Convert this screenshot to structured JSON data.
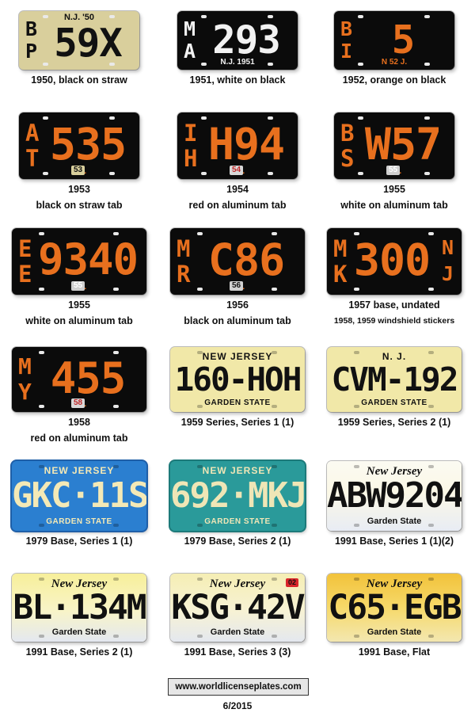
{
  "plates": [
    {
      "top": "N.J. '50",
      "prefix": [
        "B",
        "P"
      ],
      "number": "59X",
      "caption": [
        "1950, black on straw"
      ]
    },
    {
      "bottom": "N.J. 1951",
      "prefix": [
        "M",
        "A"
      ],
      "number": "293",
      "caption": [
        "1951, white on black"
      ]
    },
    {
      "bottom": "N 52 J.",
      "prefix": [
        "B",
        "I"
      ],
      "number": "5",
      "caption": [
        "1952, orange on black"
      ]
    },
    {
      "bottom": "N J.",
      "tab": "53",
      "prefix": [
        "A",
        "T"
      ],
      "number": "535",
      "caption": [
        "1953",
        "black on straw tab"
      ]
    },
    {
      "bottom": "N J.",
      "tab": "54",
      "prefix": [
        "I",
        "H"
      ],
      "number": "H94",
      "caption": [
        "1954",
        "red on aluminum tab"
      ]
    },
    {
      "bottom": "N J.",
      "tab": "55",
      "prefix": [
        "B",
        "S"
      ],
      "number": "W57",
      "caption": [
        "1955",
        "white on aluminum tab"
      ]
    },
    {
      "bottom": "N J.",
      "tab": "55",
      "prefix": [
        "E",
        "E"
      ],
      "number": "9340",
      "caption": [
        "1955",
        "white on aluminum tab"
      ]
    },
    {
      "bottom": "N J.",
      "tab": "56",
      "prefix": [
        "M",
        "R"
      ],
      "number": "C86",
      "caption": [
        "1956",
        "black on aluminum tab"
      ]
    },
    {
      "prefix": [
        "M",
        "K"
      ],
      "number": "300",
      "suffix": [
        "N",
        "J"
      ],
      "caption": [
        "1957 base, undated",
        "1958, 1959 windshield stickers"
      ]
    },
    {
      "bottom": "N J.",
      "tab": "58",
      "prefix": [
        "M",
        "Y"
      ],
      "number": "455",
      "caption": [
        "1958",
        "red on aluminum tab"
      ]
    },
    {
      "top": "NEW JERSEY",
      "number": "160-HOH",
      "bottom": "GARDEN STATE",
      "caption": [
        "1959 Series, Series 1 (1)"
      ]
    },
    {
      "top": "N. J.",
      "number": "CVM-192",
      "bottom": "GARDEN STATE",
      "caption": [
        "1959 Series, Series 2 (1)"
      ]
    },
    {
      "top": "NEW JERSEY",
      "number": "GKC·11S",
      "bottom": "GARDEN STATE",
      "caption": [
        "1979 Base, Series 1 (1)"
      ]
    },
    {
      "top": "NEW JERSEY",
      "number": "692·MKJ",
      "bottom": "GARDEN STATE",
      "caption": [
        "1979 Base, Series 2 (1)"
      ]
    },
    {
      "top": "New Jersey",
      "number": "ABW9204",
      "bottom": "Garden State",
      "caption": [
        "1991 Base, Series 1 (1)(2)"
      ]
    },
    {
      "top": "New Jersey",
      "number": "BL·134M",
      "bottom": "Garden State",
      "caption": [
        "1991 Base, Series 2 (1)"
      ]
    },
    {
      "top": "New Jersey",
      "number": "KSG·42V",
      "bottom": "Garden State",
      "sticker": "02",
      "caption": [
        "1991 Base, Series 3 (3)"
      ]
    },
    {
      "top": "New Jersey",
      "number": "C65·EGB",
      "bottom": "Garden State",
      "caption": [
        "1991 Base, Flat"
      ]
    }
  ],
  "footer": {
    "website": "www.worldlicenseplates.com",
    "date": "6/2015"
  },
  "colors": {
    "black_plate": "#0b0b0b",
    "orange": "#e8701e",
    "straw": "#d9cf9c",
    "cream": "#f1e8a8",
    "blue": "#2b7fd0",
    "teal": "#2a9a9a",
    "yellow": "#f3d84a"
  }
}
